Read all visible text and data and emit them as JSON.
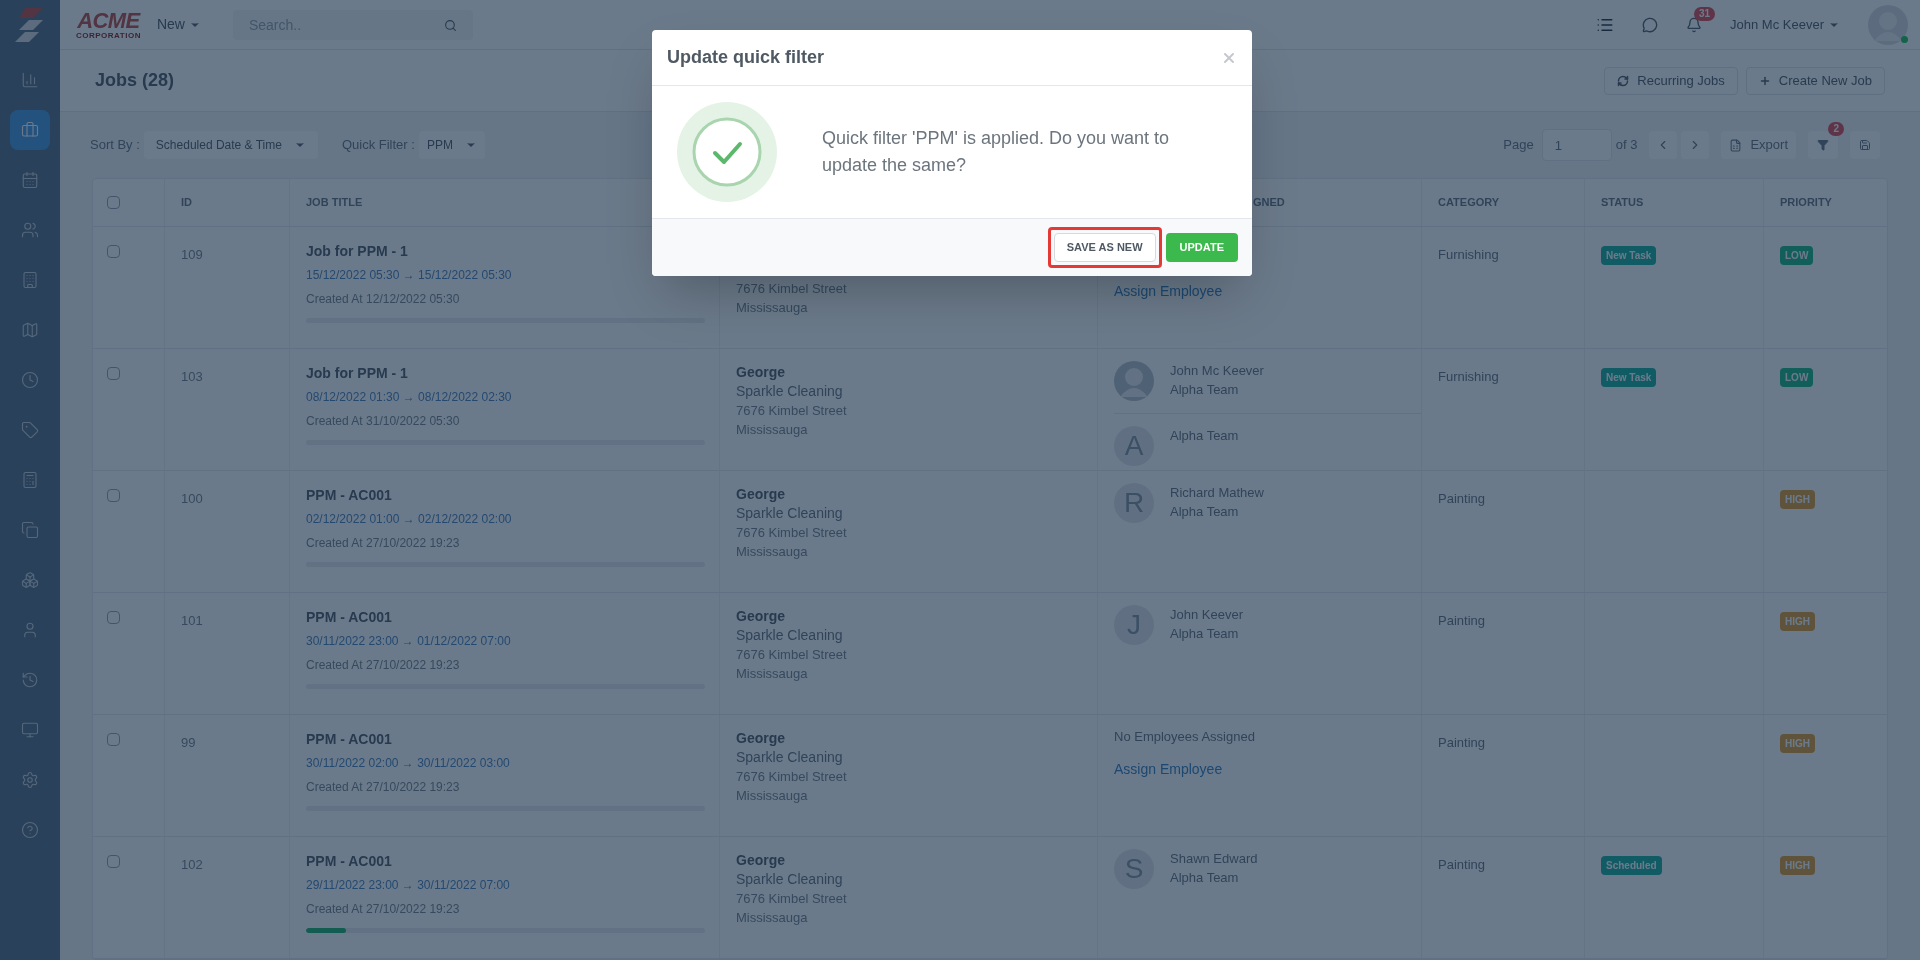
{
  "sidebar": {
    "items": [
      {
        "kind": "chart",
        "selected": false
      },
      {
        "kind": "briefcase",
        "selected": true
      },
      {
        "kind": "calendar",
        "selected": false
      },
      {
        "kind": "users",
        "selected": false
      },
      {
        "kind": "building",
        "selected": false
      },
      {
        "kind": "map",
        "selected": false
      },
      {
        "kind": "clock",
        "selected": false
      },
      {
        "kind": "tag",
        "selected": false
      },
      {
        "kind": "calculator",
        "selected": false
      },
      {
        "kind": "copy",
        "selected": false
      },
      {
        "kind": "boxes",
        "selected": false
      },
      {
        "kind": "user",
        "selected": false
      },
      {
        "kind": "history",
        "selected": false
      },
      {
        "kind": "monitor",
        "selected": false
      },
      {
        "kind": "settings",
        "selected": false
      },
      {
        "kind": "help",
        "selected": false
      }
    ]
  },
  "topbar": {
    "logo": {
      "word": "ACME",
      "tagline": "CORPORATION"
    },
    "new_menu": "New",
    "search": {
      "placeholder": "Search.."
    },
    "notifications": "31",
    "user": "John Mc Keever",
    "online": true
  },
  "header": {
    "title": "Jobs (28)",
    "buttons": [
      {
        "kind": "recurring",
        "label": "Recurring Jobs"
      },
      {
        "kind": "create",
        "label": "Create New Job"
      }
    ]
  },
  "toolbar": {
    "sort_label": "Sort By :",
    "sort_value": "Scheduled Date & Time",
    "filter_label": "Quick Filter :",
    "filter_value": "PPM",
    "page_label": "Page",
    "page": "1",
    "page_total": "of 3",
    "export": "Export",
    "filter_count": "2"
  },
  "table": {
    "select_all": {
      "checked": false
    },
    "columns": [
      "ID",
      "JOB TITLE",
      "",
      "GNED",
      "CATEGORY",
      "STATUS",
      "PRIORITY"
    ],
    "rows": [
      {
        "checked": false,
        "id": "109",
        "title": "Job for PPM - 1",
        "dates": "15/12/2022 05:30 → 15/12/2022 05:30",
        "created": "Created At 12/12/2022 05:30",
        "customer": [
          {
            "kind": "line",
            "text": "7676 Kimbel Street"
          },
          {
            "kind": "line",
            "text": "Mississauga"
          }
        ],
        "assigned": [
          {
            "kind": "link",
            "text": "Assign Employee"
          }
        ],
        "category": "Furnishing",
        "status": "New Task",
        "priority": {
          "label": "LOW",
          "kind": "low"
        }
      },
      {
        "checked": false,
        "id": "103",
        "title": "Job for PPM - 1",
        "dates": "08/12/2022 01:30 → 08/12/2022 02:30",
        "created": "Created At 31/10/2022 05:30",
        "customer": [
          {
            "kind": "name",
            "text": "George"
          },
          {
            "kind": "company",
            "text": "Sparkle Cleaning"
          },
          {
            "kind": "line",
            "text": "7676 Kimbel Street"
          },
          {
            "kind": "line",
            "text": "Mississauga"
          }
        ],
        "assigned": [
          {
            "kind": "silhouette",
            "name": "John Mc Keever",
            "team": "Alpha Team"
          },
          {
            "kind": "initial",
            "initial": "A",
            "team": "Alpha Team"
          }
        ],
        "category": "Furnishing",
        "status": "New Task",
        "priority": {
          "label": "LOW",
          "kind": "low"
        }
      },
      {
        "checked": false,
        "id": "100",
        "title": "PPM - AC001",
        "dates": "02/12/2022 01:00 → 02/12/2022 02:00",
        "created": "Created At 27/10/2022 19:23",
        "customer": [
          {
            "kind": "name",
            "text": "George"
          },
          {
            "kind": "company",
            "text": "Sparkle Cleaning"
          },
          {
            "kind": "line",
            "text": "7676 Kimbel Street"
          },
          {
            "kind": "line",
            "text": "Mississauga"
          }
        ],
        "assigned": [
          {
            "kind": "initial",
            "initial": "R",
            "name": "Richard Mathew",
            "team": "Alpha Team"
          }
        ],
        "category": "Painting",
        "priority": {
          "label": "HIGH",
          "kind": "high"
        }
      },
      {
        "checked": false,
        "id": "101",
        "title": "PPM - AC001",
        "dates": "30/11/2022 23:00 → 01/12/2022 07:00",
        "created": "Created At 27/10/2022 19:23",
        "customer": [
          {
            "kind": "name",
            "text": "George"
          },
          {
            "kind": "company",
            "text": "Sparkle Cleaning"
          },
          {
            "kind": "line",
            "text": "7676 Kimbel Street"
          },
          {
            "kind": "line",
            "text": "Mississauga"
          }
        ],
        "assigned": [
          {
            "kind": "initial",
            "initial": "J",
            "name": "John Keever",
            "team": "Alpha Team"
          }
        ],
        "category": "Painting",
        "priority": {
          "label": "HIGH",
          "kind": "high"
        }
      },
      {
        "checked": false,
        "id": "99",
        "title": "PPM - AC001",
        "dates": "30/11/2022 02:00 → 30/11/2022 03:00",
        "created": "Created At 27/10/2022 19:23",
        "customer": [
          {
            "kind": "name",
            "text": "George"
          },
          {
            "kind": "company",
            "text": "Sparkle Cleaning"
          },
          {
            "kind": "line",
            "text": "7676 Kimbel Street"
          },
          {
            "kind": "line",
            "text": "Mississauga"
          }
        ],
        "assigned": [
          {
            "kind": "note",
            "text": "No Employees Assigned"
          },
          {
            "kind": "link",
            "text": "Assign Employee"
          }
        ],
        "category": "Painting",
        "priority": {
          "label": "HIGH",
          "kind": "high"
        }
      },
      {
        "checked": false,
        "id": "102",
        "title": "PPM - AC001",
        "dates": "29/11/2022 23:00 → 30/11/2022 07:00",
        "created": "Created At 27/10/2022 19:23",
        "level": 0.1,
        "customer": [
          {
            "kind": "name",
            "text": "George"
          },
          {
            "kind": "company",
            "text": "Sparkle Cleaning"
          },
          {
            "kind": "line",
            "text": "7676 Kimbel Street"
          },
          {
            "kind": "line",
            "text": "Mississauga"
          }
        ],
        "assigned": [
          {
            "kind": "initial",
            "initial": "S",
            "name": "Shawn Edward",
            "team": "Alpha Team"
          }
        ],
        "category": "Painting",
        "status": "Scheduled",
        "priority": {
          "label": "HIGH",
          "kind": "high"
        }
      }
    ]
  },
  "dialog": {
    "title": "Update quick filter",
    "message": "Quick filter 'PPM' is applied. Do you want to update the same?",
    "buttons": [
      {
        "kind": "secondary",
        "label": "SAVE AS NEW",
        "highlighted": true
      },
      {
        "kind": "primary",
        "label": "UPDATE",
        "highlighted": false
      }
    ]
  }
}
